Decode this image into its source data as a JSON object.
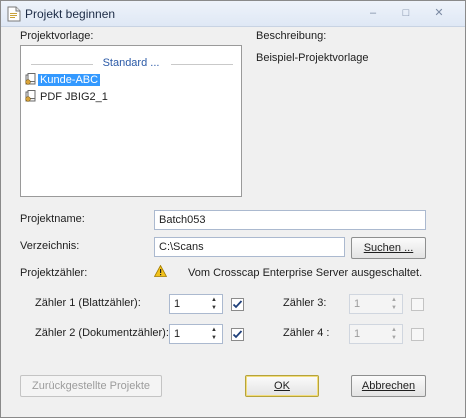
{
  "window": {
    "title": "Projekt beginnen",
    "controls": {
      "minimize": "–",
      "maximize": "□",
      "close": "✕"
    }
  },
  "template": {
    "label": "Projektvorlage:",
    "group_title": "Standard ...",
    "items": [
      {
        "label": "Kunde-ABC",
        "selected": true,
        "icon": "template-icon"
      },
      {
        "label": "PDF JBIG2_1",
        "selected": false,
        "icon": "template-icon"
      }
    ]
  },
  "description": {
    "label": "Beschreibung:",
    "text": "Beispiel-Projektvorlage"
  },
  "project_name": {
    "label": "Projektname:",
    "value": "Batch053"
  },
  "directory": {
    "label": "Verzeichnis:",
    "value": "C:\\Scans",
    "browse_button": "Suchen ..."
  },
  "counter": {
    "label": "Projektzähler:",
    "warning_icon": "warning-icon",
    "warning_text": "Vom Crosscap Enterprise Server ausgeschaltet.",
    "counters": [
      {
        "label": "Zähler 1 (Blattzähler):",
        "value": "1",
        "enabled": true,
        "checked": true
      },
      {
        "label": "Zähler 2 (Dokumentzähler):",
        "value": "1",
        "enabled": true,
        "checked": true
      },
      {
        "label": "Zähler 3:",
        "value": "1",
        "enabled": false,
        "checked": false
      },
      {
        "label": "Zähler 4 :",
        "value": "1",
        "enabled": false,
        "checked": false
      }
    ]
  },
  "buttons": {
    "deferred": "Zurückgestellte Projekte",
    "ok": "OK",
    "cancel": "Abbrechen"
  },
  "colors": {
    "selection": "#3399ff",
    "group_title": "#2b5aa7",
    "default_button_border": "#b5a33c"
  }
}
